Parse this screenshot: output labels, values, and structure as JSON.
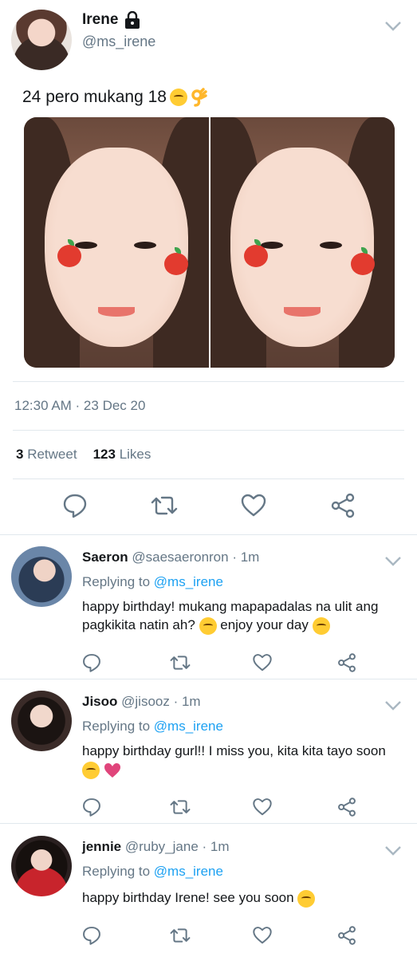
{
  "tweet": {
    "name": "Irene",
    "handle": "@ms_irene",
    "text": "24 pero mukang 18",
    "timestamp": "12:30 AM · 23 Dec 20",
    "retweet_count": "3",
    "retweet_label": "Retweet",
    "like_count": "123",
    "like_label": "Likes"
  },
  "replies": [
    {
      "name": "Saeron",
      "handle": "@saesaeronron",
      "time": " · 1m",
      "replying_label": "Replying to ",
      "replying_to": "@ms_irene",
      "text": "happy birthday! mukang mapapadalas na ulit ang pagkikita natin ah?",
      "text2": "enjoy your day"
    },
    {
      "name": "Jisoo",
      "handle": "@jisooz",
      "time": " · 1m",
      "replying_label": "Replying to ",
      "replying_to": "@ms_irene",
      "text": "happy birthday gurl!! I miss you, kita kita tayo soon"
    },
    {
      "name": "jennie",
      "handle": "@ruby_jane",
      "time": " · 1m",
      "replying_label": "Replying to ",
      "replying_to": "@ms_irene",
      "text": "happy birthday Irene! see you soon"
    }
  ],
  "icons": [
    "lock-icon",
    "chevron-down-icon",
    "reply-icon",
    "retweet-icon",
    "like-icon",
    "share-icon"
  ],
  "colors": {
    "link": "#1da1f2",
    "secondary_text": "#657786",
    "divider": "#e1e8ed",
    "icon": "#657786"
  }
}
